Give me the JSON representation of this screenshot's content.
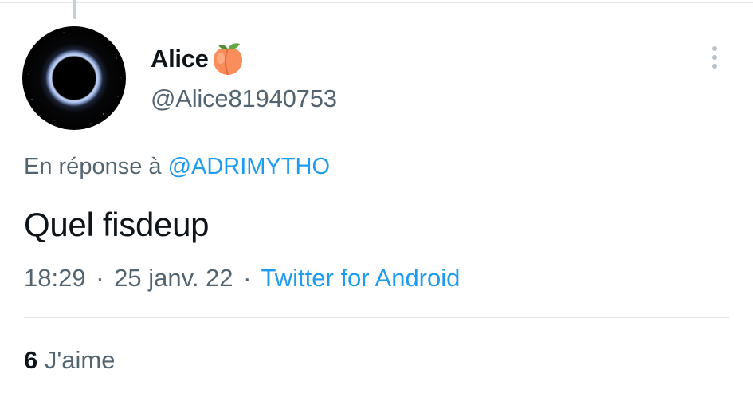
{
  "tweet": {
    "author": {
      "display_name": "Alice",
      "name_emoji": "peach-icon",
      "handle": "@Alice81940753"
    },
    "reply_prefix": "En réponse à",
    "reply_to": "@ADRIMYTHO",
    "text": "Quel fisdeup",
    "time": "18:29",
    "separator": "·",
    "date": "25 janv. 22",
    "source": "Twitter for Android",
    "likes_count": "6",
    "likes_label": "J'aime"
  },
  "colors": {
    "link": "#1d9bf0",
    "secondary_text": "#536471",
    "primary_text": "#0f1419",
    "divider": "#e1e5e8"
  },
  "icons": [
    "peach-icon",
    "more-options-icon"
  ]
}
